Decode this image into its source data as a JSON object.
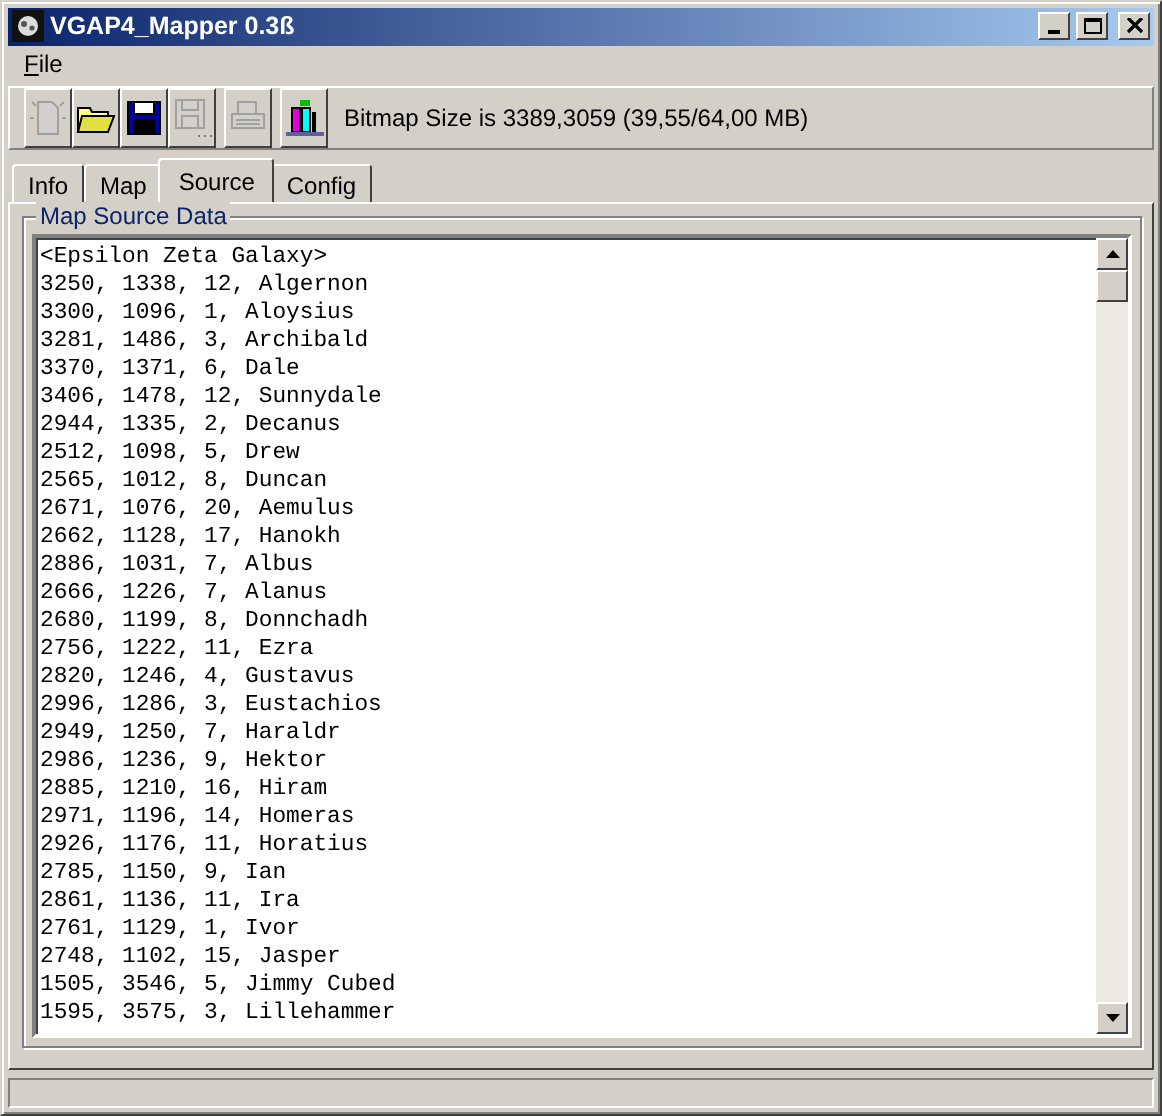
{
  "window": {
    "title": "VGAP4_Mapper 0.3ß"
  },
  "menu": [
    {
      "mnemonic": "F",
      "rest": "ile"
    }
  ],
  "toolbar": {
    "buttons": [
      {
        "kind": "new",
        "disabled": true
      },
      {
        "kind": "open",
        "disabled": false
      },
      {
        "kind": "save",
        "disabled": false
      },
      {
        "kind": "save-as",
        "disabled": true
      },
      {
        "kind": "print",
        "disabled": true
      },
      {
        "kind": "map",
        "disabled": false
      }
    ],
    "info": "Bitmap Size is 3389,3059 (39,55/64,00 MB)"
  },
  "tabs": [
    {
      "label": "Info",
      "selected": false
    },
    {
      "label": "Map",
      "selected": false
    },
    {
      "label": "Source",
      "selected": true
    },
    {
      "label": "Config",
      "selected": false
    }
  ],
  "group": {
    "title": "Map Source Data",
    "lines": [
      "<Epsilon Zeta Galaxy>",
      "3250, 1338, 12, Algernon",
      "3300, 1096, 1, Aloysius",
      "3281, 1486, 3, Archibald",
      "3370, 1371, 6, Dale",
      "3406, 1478, 12, Sunnydale",
      "2944, 1335, 2, Decanus",
      "2512, 1098, 5, Drew",
      "2565, 1012, 8, Duncan",
      "2671, 1076, 20, Aemulus",
      "2662, 1128, 17, Hanokh",
      "2886, 1031, 7, Albus",
      "2666, 1226, 7, Alanus",
      "2680, 1199, 8, Donnchadh",
      "2756, 1222, 11, Ezra",
      "2820, 1246, 4, Gustavus",
      "2996, 1286, 3, Eustachios",
      "2949, 1250, 7, Haraldr",
      "2986, 1236, 9, Hektor",
      "2885, 1210, 16, Hiram",
      "2971, 1196, 14, Homeras",
      "2926, 1176, 11, Horatius",
      "2785, 1150, 9, Ian",
      "2861, 1136, 11, Ira",
      "2761, 1129, 1, Ivor",
      "2748, 1102, 15, Jasper",
      "1505, 3546, 5, Jimmy Cubed",
      "1595, 3575, 3, Lillehammer"
    ]
  }
}
